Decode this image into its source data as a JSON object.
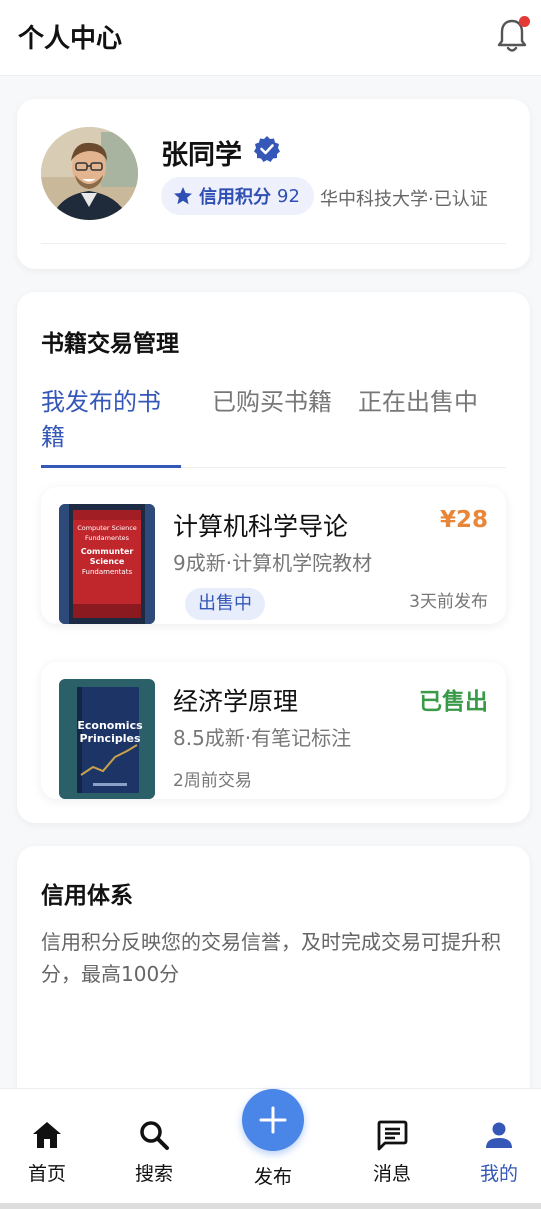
{
  "header": {
    "title": "个人中心",
    "icon": "bell-icon",
    "notification_dot_color": "#e53935"
  },
  "profile": {
    "name": "张同学",
    "verified_icon": "verified-badge-icon",
    "credit_label": "信用积分",
    "credit_score": "92",
    "school": "华中科技大学·已认证"
  },
  "books_section": {
    "title": "书籍交易管理",
    "tabs": [
      {
        "label": "我发布的书籍",
        "active": true
      },
      {
        "label": "已购买书籍",
        "active": false
      },
      {
        "label": "正在出售中",
        "active": false
      }
    ],
    "items": [
      {
        "title": "计算机科学导论",
        "price": "¥28",
        "price_color": "#e8863a",
        "desc": "9成新·计算机学院教材",
        "status": "出售中",
        "time": "3天前发布",
        "cover_lines": [
          "Computer Science",
          "Fundamentes",
          "Communter",
          "Science",
          "Fundamentats"
        ]
      },
      {
        "title": "经济学原理",
        "price": "已售出",
        "price_color": "#3a9a4a",
        "desc": "8.5成新·有笔记标注",
        "time": "2周前交易",
        "cover_lines": [
          "Economics",
          "Principles"
        ]
      }
    ]
  },
  "credit_section": {
    "title": "信用体系",
    "text": "信用积分反映您的交易信誉，及时完成交易可提升积分，最高100分"
  },
  "bottom_nav": {
    "items": [
      {
        "label": "首页",
        "icon": "home-icon"
      },
      {
        "label": "搜索",
        "icon": "search-icon"
      },
      {
        "label": "发布",
        "icon": "plus-icon"
      },
      {
        "label": "消息",
        "icon": "message-icon"
      },
      {
        "label": "我的",
        "icon": "person-icon",
        "active": true
      }
    ]
  },
  "colors": {
    "accent": "#3558b8",
    "fab": "#4a86e8"
  }
}
